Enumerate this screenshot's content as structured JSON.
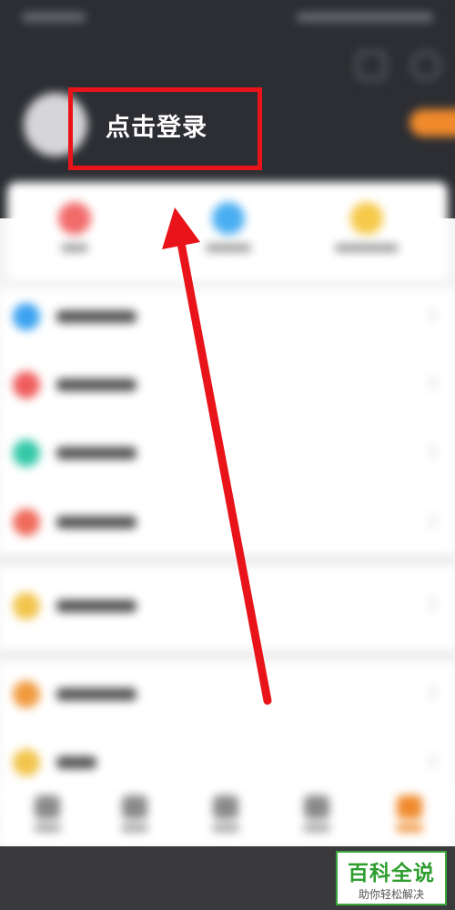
{
  "profile": {
    "login_label": "点击登录"
  },
  "colors": {
    "header_bg": "#2c2e33",
    "annotation_red": "#e8141a",
    "accent_orange": "#f08a2c",
    "watermark_green": "#2f9e2f"
  },
  "icons": {
    "settings": "settings-icon",
    "message": "message-icon"
  },
  "quick_actions": [
    {
      "icon": "red-circle-icon",
      "color": "#f26b6b"
    },
    {
      "icon": "blue-circle-icon",
      "color": "#4aaef2"
    },
    {
      "icon": "yellow-circle-icon",
      "color": "#f6c94a"
    }
  ],
  "menu": [
    {
      "icon_color": "#3ba2f0"
    },
    {
      "icon_color": "#ef5c5c"
    },
    {
      "icon_color": "#35c8a8"
    },
    {
      "icon_color": "#ef6a5a"
    },
    {
      "icon_color": "#f2c44c"
    },
    {
      "icon_color": "#f19a3e"
    },
    {
      "icon_color": "#f2c44c"
    }
  ],
  "watermark": {
    "title": "百科全说",
    "subtitle": "助你轻松解决"
  }
}
